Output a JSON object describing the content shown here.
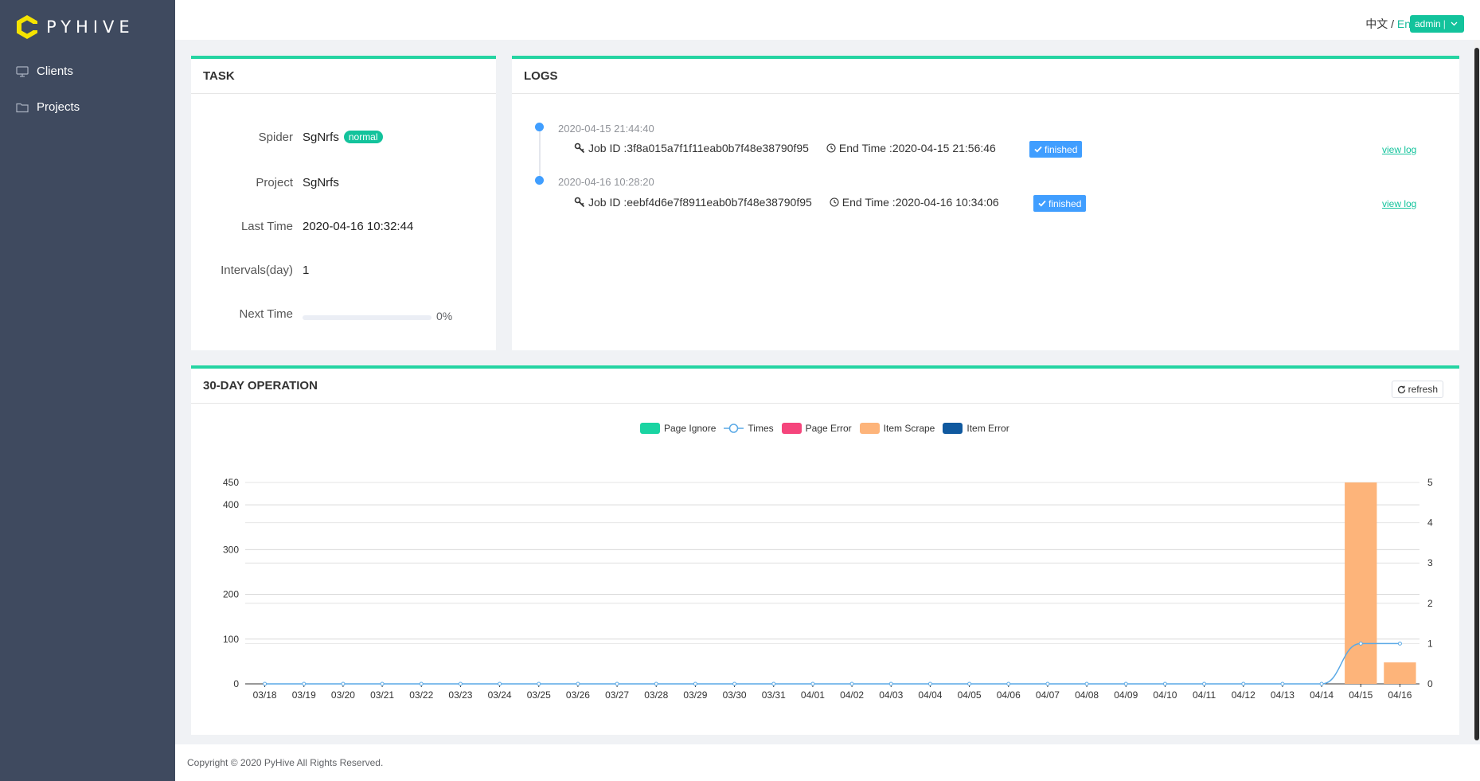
{
  "app": {
    "name": "PYHIVE"
  },
  "sidebar": {
    "items": [
      {
        "label": "Clients",
        "icon": "monitor-icon"
      },
      {
        "label": "Projects",
        "icon": "folder-icon"
      }
    ]
  },
  "header": {
    "lang_zh": "中文",
    "lang_sep": " / ",
    "lang_en": "En",
    "user": "admin"
  },
  "task": {
    "title": "TASK",
    "spider_label": "Spider",
    "spider_value": "SgNrfs",
    "spider_badge": "normal",
    "project_label": "Project",
    "project_value": "SgNrfs",
    "last_time_label": "Last Time",
    "last_time_value": "2020-04-16 10:32:44",
    "intervals_label": "Intervals(day)",
    "intervals_value": "1",
    "next_time_label": "Next Time",
    "next_time_progress": "0%",
    "next_time_fraction": 0
  },
  "logs": {
    "title": "LOGS",
    "job_id_label": "Job ID : ",
    "end_time_label": "End Time : ",
    "view_log_label": "view log",
    "entries": [
      {
        "timestamp": "2020-04-15 21:44:40",
        "job_id": "3f8a015a7f1f11eab0b7f48e38790f95",
        "end_time": "2020-04-15 21:56:46",
        "status": "finished"
      },
      {
        "timestamp": "2020-04-16 10:28:20",
        "job_id": "eebf4d6e7f8911eab0b7f48e38790f95",
        "end_time": "2020-04-16 10:34:06",
        "status": "finished"
      }
    ]
  },
  "operation": {
    "title": "30-DAY OPERATION",
    "refresh_label": "refresh"
  },
  "chart_data": {
    "type": "bar",
    "categories": [
      "03/18",
      "03/19",
      "03/20",
      "03/21",
      "03/22",
      "03/23",
      "03/24",
      "03/25",
      "03/26",
      "03/27",
      "03/28",
      "03/29",
      "03/30",
      "03/31",
      "04/01",
      "04/02",
      "04/03",
      "04/04",
      "04/05",
      "04/06",
      "04/07",
      "04/08",
      "04/09",
      "04/10",
      "04/11",
      "04/12",
      "04/13",
      "04/14",
      "04/15",
      "04/16"
    ],
    "series": [
      {
        "name": "Page Ignore",
        "type": "bar",
        "color": "#1ad4a2",
        "values": [
          0,
          0,
          0,
          0,
          0,
          0,
          0,
          0,
          0,
          0,
          0,
          0,
          0,
          0,
          0,
          0,
          0,
          0,
          0,
          0,
          0,
          0,
          0,
          0,
          0,
          0,
          0,
          0,
          0,
          0
        ]
      },
      {
        "name": "Times",
        "type": "line",
        "axis": "right",
        "color": "#5aa9e6",
        "values": [
          0,
          0,
          0,
          0,
          0,
          0,
          0,
          0,
          0,
          0,
          0,
          0,
          0,
          0,
          0,
          0,
          0,
          0,
          0,
          0,
          0,
          0,
          0,
          0,
          0,
          0,
          0,
          0,
          1,
          1
        ]
      },
      {
        "name": "Page Error",
        "type": "bar",
        "color": "#f5457c",
        "values": [
          0,
          0,
          0,
          0,
          0,
          0,
          0,
          0,
          0,
          0,
          0,
          0,
          0,
          0,
          0,
          0,
          0,
          0,
          0,
          0,
          0,
          0,
          0,
          0,
          0,
          0,
          0,
          0,
          0,
          0
        ]
      },
      {
        "name": "Item Scrape",
        "type": "bar",
        "color": "#fdb47a",
        "values": [
          0,
          0,
          0,
          0,
          0,
          0,
          0,
          0,
          0,
          0,
          0,
          0,
          0,
          0,
          0,
          0,
          0,
          0,
          0,
          0,
          0,
          0,
          0,
          0,
          0,
          0,
          0,
          0,
          450,
          48
        ]
      },
      {
        "name": "Item Error",
        "type": "bar",
        "color": "#10599f",
        "values": [
          0,
          0,
          0,
          0,
          0,
          0,
          0,
          0,
          0,
          0,
          0,
          0,
          0,
          0,
          0,
          0,
          0,
          0,
          0,
          0,
          0,
          0,
          0,
          0,
          0,
          0,
          0,
          0,
          0,
          0
        ]
      }
    ],
    "y_left": {
      "ticks": [
        0,
        100,
        200,
        300,
        400,
        450
      ],
      "range": [
        0,
        450
      ]
    },
    "y_right": {
      "ticks": [
        0,
        1,
        2,
        3,
        4,
        5
      ],
      "range": [
        0,
        5
      ]
    },
    "legend_position": "top-center",
    "grid": true
  },
  "footer": {
    "copyright": "Copyright © 2020 PyHive All Rights Reserved."
  }
}
